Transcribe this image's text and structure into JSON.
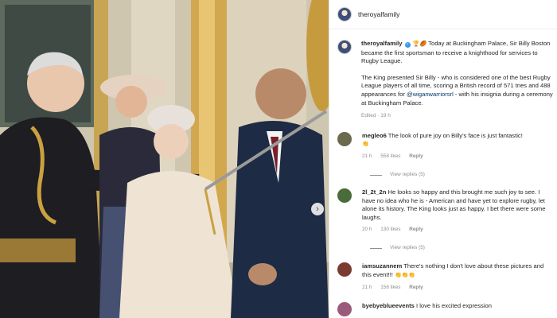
{
  "post": {
    "arrow_icon": "›",
    "header_username": "theroyalfamily"
  },
  "caption": {
    "username": "theroyalfamily",
    "verified_mark": "✓",
    "emojis": "🏆🏉",
    "text_1": "Today at Buckingham Palace, Sir Billy Boston became the first sportsman to receive a knighthood for services to Rugby League.",
    "text_2a": "The King presented Sir Billy - who is considered one of the best Rugby League players of all time, scoring a British record of 571 tries and 488 appearances for ",
    "mention": "@wiganwarriorsrl",
    "text_2b": " - with his insignia during a ceremony at Buckingham Palace.",
    "meta": "Edited · 19 h"
  },
  "comments": [
    {
      "username": "megleo6",
      "text": "The look of pure joy on Billy's face is just fantastic!",
      "emoji": "👏",
      "time": "21 h",
      "likes": "558 likes",
      "reply": "Reply",
      "view_replies": "View replies (5)",
      "avatar_color": "#6b6a4e"
    },
    {
      "username": "2l_2t_2n",
      "text": "He looks so happy and this brought me such joy to see. I have no idea who he is - American and have yet to explore rugby, let alone its history. The King looks just as happy. I bet there were some laughs.",
      "emoji": "",
      "time": "20 h",
      "likes": "130 likes",
      "reply": "Reply",
      "view_replies": "View replies (5)",
      "avatar_color": "#4a6b3a"
    },
    {
      "username": "iamsuzannem",
      "text": "There's nothing I don't love about these pictures and this event!!!",
      "emoji": "👏👏👏",
      "time": "21 h",
      "likes": "156 likes",
      "reply": "Reply",
      "view_replies": "",
      "avatar_color": "#7a3a2f"
    },
    {
      "username": "byebyeblueevents",
      "text": "I love his excited expression",
      "emoji": "",
      "time": "",
      "likes": "",
      "reply": "",
      "view_replies": "",
      "avatar_color": "#9a5a7a"
    }
  ],
  "colors": {
    "verified": "#3897f0",
    "mention": "#00376b",
    "muted": "#8e8e8e"
  }
}
